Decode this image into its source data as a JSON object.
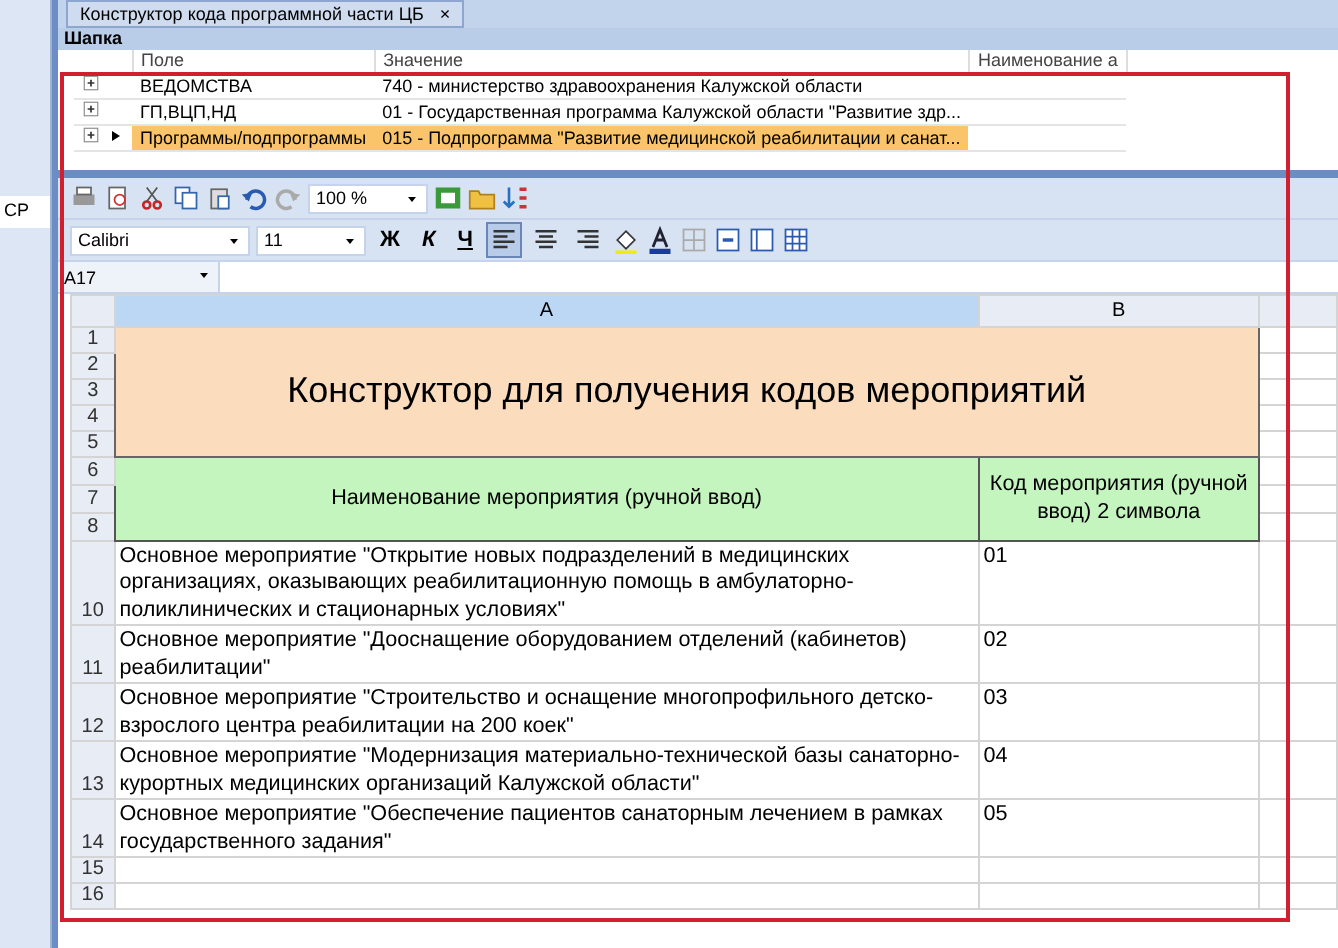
{
  "document_tab": {
    "title": "Конструктор кода программной части ЦБ",
    "close": "×"
  },
  "sidebar": {
    "label": "СР"
  },
  "header_panel": {
    "title": "Шапка",
    "columns": [
      "Поле",
      "Значение",
      "Наименование а"
    ],
    "rows": [
      {
        "field": "ВЕДОМСТВА",
        "value": "740 - министерство здравоохранения Калужской области",
        "selected": false
      },
      {
        "field": "ГП,ВЦП,НД",
        "value": "01 - Государственная программа Калужской области \"Развитие здр...",
        "selected": false
      },
      {
        "field": "Программы/подпрограммы",
        "value": "015 - Подпрограмма \"Развитие медицинской реабилитации и санат...",
        "selected": true
      }
    ]
  },
  "toolbar": {
    "zoom": "100 %",
    "font": "Calibri",
    "font_size": "11",
    "bold": "Ж",
    "italic": "К",
    "underline": "Ч",
    "align": [
      {
        "kind": "left",
        "selected": true
      },
      {
        "kind": "center",
        "selected": false
      },
      {
        "kind": "right",
        "selected": false
      }
    ]
  },
  "formula_bar": {
    "cell": "A17"
  },
  "sheet": {
    "columns": [
      {
        "label": "A",
        "selected": true
      },
      {
        "label": "B",
        "selected": false
      }
    ],
    "title": {
      "rows": [
        "1",
        "2",
        "3",
        "4",
        "5"
      ],
      "text": "Конструктор для получения кодов мероприятий"
    },
    "header": {
      "rows": [
        "6",
        "7",
        "8"
      ],
      "name": "Наименование мероприятия (ручной ввод)",
      "code": "Код мероприятия (ручной ввод) 2 символа"
    },
    "items": [
      {
        "row": "10",
        "name": "Основное мероприятие \"Открытие новых подразделений в медицинских организациях, оказывающих реабилитационную помощь в амбулаторно-поликлинических и стационарных условиях\"",
        "code": "01"
      },
      {
        "row": "11",
        "name": "Основное мероприятие \"Дооснащение оборудованием отделений (кабинетов) реабилитации\"",
        "code": "02"
      },
      {
        "row": "12",
        "name": "Основное мероприятие \"Строительство и оснащение многопрофильного детско-взрослого центра реабилитации на 200 коек\"",
        "code": "03"
      },
      {
        "row": "13",
        "name": "Основное мероприятие \"Модернизация материально-технической базы санаторно-курортных медицинских организаций Калужской области\"",
        "code": "04"
      },
      {
        "row": "14",
        "name": "Основное мероприятие \"Обеспечение пациентов санаторным лечением в рамках государственного задания\"",
        "code": "05"
      }
    ],
    "empty_rows": [
      "15",
      "16"
    ]
  }
}
